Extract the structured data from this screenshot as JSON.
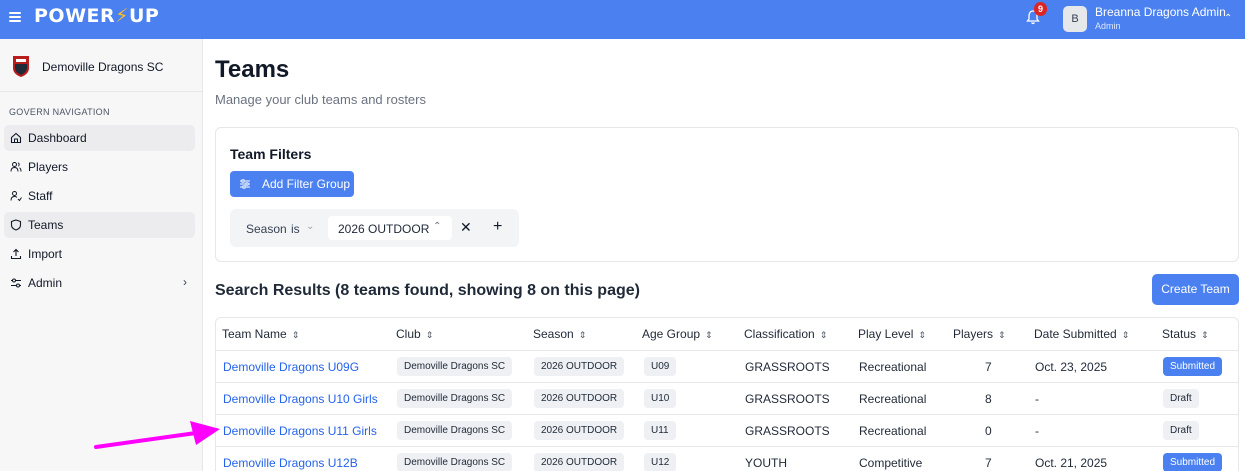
{
  "header": {
    "logo_text_a": "POWER",
    "logo_text_b": "UP",
    "notification_count": "9",
    "user_initial": "B",
    "user_name": "Breanna Dragons Admin",
    "user_role": "Admin"
  },
  "sidebar": {
    "club_name": "Demoville Dragons SC",
    "nav_heading": "GOVERN NAVIGATION",
    "items": [
      {
        "label": "Dashboard",
        "icon": "home-icon"
      },
      {
        "label": "Players",
        "icon": "users-icon"
      },
      {
        "label": "Staff",
        "icon": "staff-icon"
      },
      {
        "label": "Teams",
        "icon": "shield-icon"
      },
      {
        "label": "Import",
        "icon": "upload-icon"
      },
      {
        "label": "Admin",
        "icon": "settings-icon"
      }
    ]
  },
  "main": {
    "title": "Teams",
    "subtitle": "Manage your club teams and rosters",
    "filters": {
      "title": "Team Filters",
      "add_group_label": "Add Filter Group",
      "field": "Season",
      "operator": "is",
      "value": "2026 OUTDOOR"
    },
    "results_title": "Search Results (8 teams found, showing 8 on this page)",
    "create_label": "Create Team",
    "columns": [
      "Team Name",
      "Club",
      "Season",
      "Age Group",
      "Classification",
      "Play Level",
      "Players",
      "Date Submitted",
      "Status"
    ],
    "rows": [
      {
        "team": "Demoville Dragons U09G",
        "club": "Demoville Dragons SC",
        "season": "2026 OUTDOOR",
        "age": "U09",
        "classification": "GRASSROOTS",
        "level": "Recreational",
        "players": "7",
        "date": "Oct. 23, 2025",
        "status": "Submitted"
      },
      {
        "team": "Demoville Dragons U10 Girls",
        "club": "Demoville Dragons SC",
        "season": "2026 OUTDOOR",
        "age": "U10",
        "classification": "GRASSROOTS",
        "level": "Recreational",
        "players": "8",
        "date": "-",
        "status": "Draft"
      },
      {
        "team": "Demoville Dragons U11 Girls",
        "club": "Demoville Dragons SC",
        "season": "2026 OUTDOOR",
        "age": "U11",
        "classification": "GRASSROOTS",
        "level": "Recreational",
        "players": "0",
        "date": "-",
        "status": "Draft"
      },
      {
        "team": "Demoville Dragons U12B",
        "club": "Demoville Dragons SC",
        "season": "2026 OUTDOOR",
        "age": "U12",
        "classification": "YOUTH",
        "level": "Competitive",
        "players": "7",
        "date": "Oct. 21, 2025",
        "status": "Submitted"
      }
    ]
  },
  "colors": {
    "brand": "#4a80f0",
    "link": "#2563eb",
    "annotation_arrow": "#ff00ff",
    "badge": "#dc2626"
  }
}
